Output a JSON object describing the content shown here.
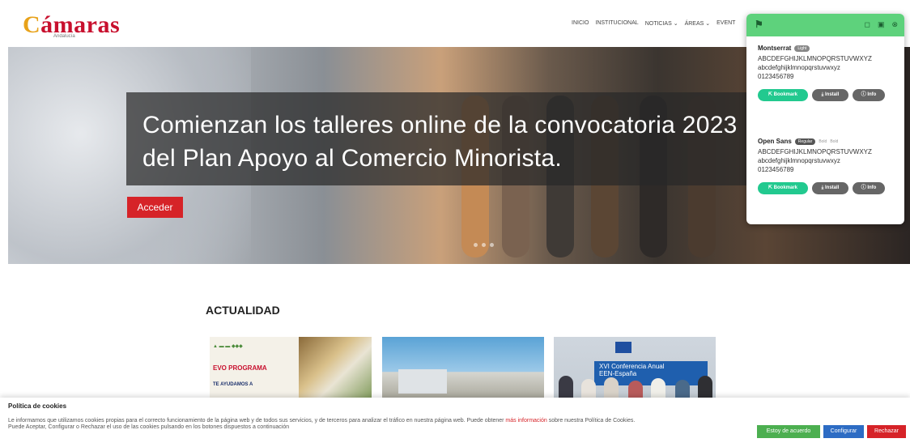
{
  "header": {
    "logo_text": "ámaras",
    "logo_c": "C",
    "logo_sub": "Andalucía",
    "nav": [
      "INICIO",
      "INSTITUCIONAL",
      "NOTICIAS ⌄",
      "ÁREAS ⌄",
      "EVENT"
    ]
  },
  "hero": {
    "title_line1": "Comienzan los talleres online  de la convocatoria 2023",
    "title_line2": "del  Plan Apoyo al Comercio Minorista.",
    "button": "Acceder"
  },
  "news": {
    "section_title": "ACTUALIDAD",
    "card1": {
      "text1": "EVO PROGRAMA",
      "text2": "TE AYUDAMOS A"
    },
    "card3": {
      "text1": "XVI Conferencia Anual",
      "text2": "EEN-España"
    }
  },
  "cookies": {
    "title": "Política de cookies",
    "text_before": "Le informamos que utilizamos cookies propias para el correcto funcionamiento de la página web y de todos sus servicios, y de terceros para analizar el tráfico en nuestra página web. Puede obtener ",
    "link": "más información",
    "text_after": " sobre nuestra Política de Cookies. Puede Aceptar, Configurar o Rechazar el uso de las cookies pulsando en los botones dispuestos a continuación",
    "accept": "Estoy de acuerdo",
    "configure": "Configurar",
    "reject": "Rechazar"
  },
  "font_panel": {
    "icons": [
      "bookmark-icon",
      "save-icon",
      "close-icon"
    ],
    "font1": {
      "name": "Montserrat",
      "weight": "Light",
      "upper": "ABCDEFGHIJKLMNOPQRSTUVWXYZ",
      "lower": "abcdefghijklmnopqrstuvwxyz",
      "digits": "0123456789"
    },
    "font2": {
      "name": "Open Sans",
      "weight": "Regular",
      "weight2": "Bold",
      "weight3": "Bold",
      "upper": "ABCDEFGHIJKLMNOPQRSTUVWXYZ",
      "lower": "abcdefghijklmnopqrstuvwxyz",
      "digits": "0123456789"
    },
    "bookmark": "Bookmark",
    "install": "Install",
    "info": "Info"
  },
  "colors": {
    "brand_red": "#c8102e",
    "panel_green": "#5ed27c",
    "accept_green": "#4caf50",
    "configure_blue": "#2d6cc4"
  }
}
